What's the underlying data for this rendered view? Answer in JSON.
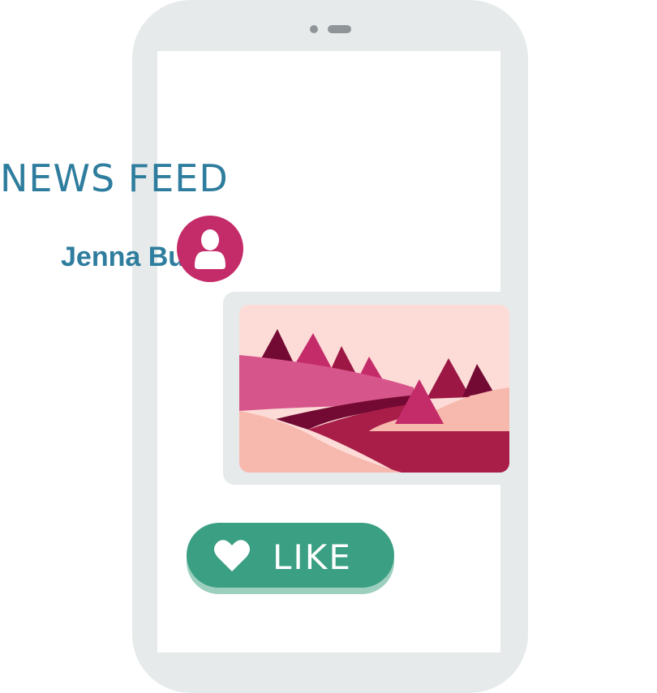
{
  "header": {
    "title": "NEWS FEED"
  },
  "post": {
    "author": "Jenna Bu",
    "like_label": "LIKE"
  },
  "icons": {
    "avatar": "user-icon",
    "like": "heart-icon",
    "image": "landscape-image"
  },
  "colors": {
    "title": "#2e7d9e",
    "accent": "#c42b69",
    "like": "#3a9f83",
    "frame": "#e6eaea"
  }
}
